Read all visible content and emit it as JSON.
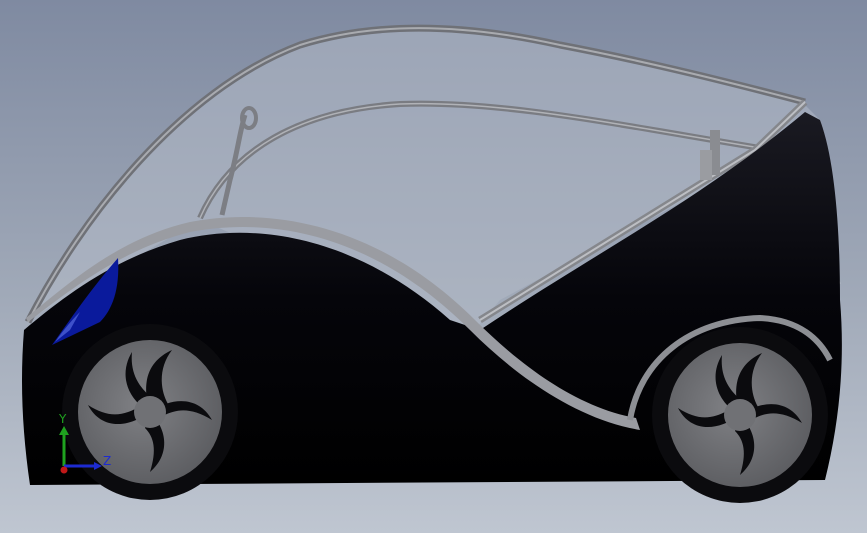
{
  "viewport": {
    "background_top": "#7f8aa1",
    "background_bottom": "#bfc6d1"
  },
  "model": {
    "subject": "electric-city-car",
    "body_color": "#05050a",
    "trim_color": "#8f9196",
    "canopy_tint": "#b3bac6",
    "headlight_color": "#0a1a9c",
    "wheel_color": "#6e6f73"
  },
  "triad": {
    "y_label": "Y",
    "z_label": "Z",
    "y_color": "#1fa21f",
    "z_color": "#1d2bd1",
    "x_color": "#c01818"
  }
}
